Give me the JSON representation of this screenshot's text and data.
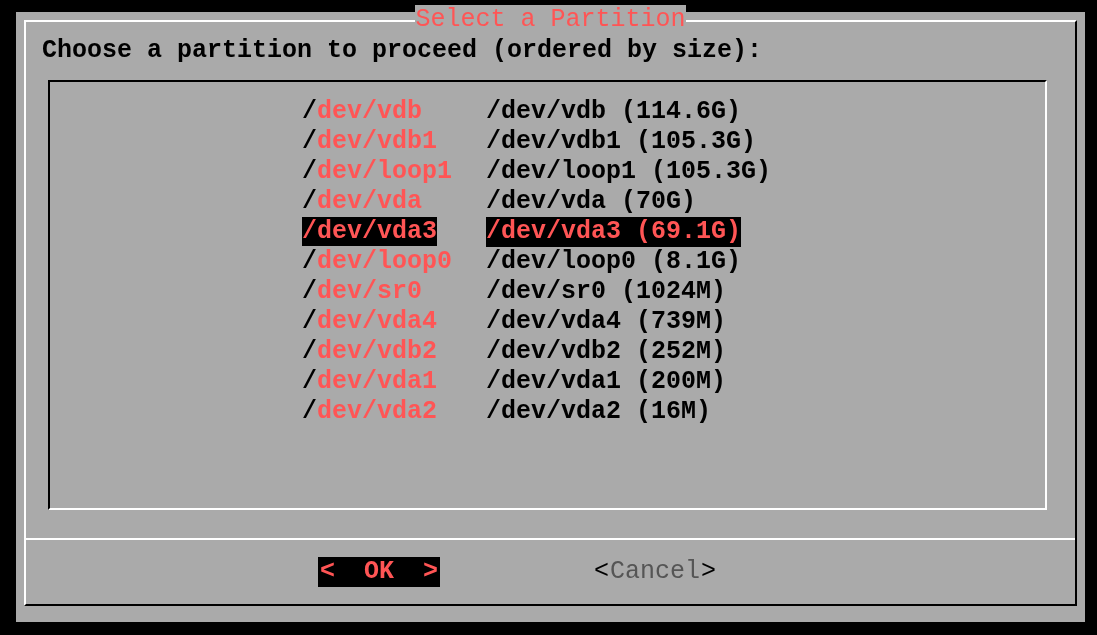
{
  "dialog": {
    "title": "Select a Partition",
    "prompt": "Choose a partition to proceed (ordered by size):",
    "partitions": [
      {
        "tag": "/dev/vdb",
        "item": "/dev/vdb (114.6G)",
        "selected": false
      },
      {
        "tag": "/dev/vdb1",
        "item": "/dev/vdb1 (105.3G)",
        "selected": false
      },
      {
        "tag": "/dev/loop1",
        "item": "/dev/loop1 (105.3G)",
        "selected": false
      },
      {
        "tag": "/dev/vda",
        "item": "/dev/vda (70G)",
        "selected": false
      },
      {
        "tag": "/dev/vda3",
        "item": "/dev/vda3 (69.1G)",
        "selected": true
      },
      {
        "tag": "/dev/loop0",
        "item": "/dev/loop0 (8.1G)",
        "selected": false
      },
      {
        "tag": "/dev/sr0",
        "item": "/dev/sr0 (1024M)",
        "selected": false
      },
      {
        "tag": "/dev/vda4",
        "item": "/dev/vda4 (739M)",
        "selected": false
      },
      {
        "tag": "/dev/vdb2",
        "item": "/dev/vdb2 (252M)",
        "selected": false
      },
      {
        "tag": "/dev/vda1",
        "item": "/dev/vda1 (200M)",
        "selected": false
      },
      {
        "tag": "/dev/vda2",
        "item": "/dev/vda2 (16M)",
        "selected": false
      }
    ],
    "buttons": [
      {
        "left": "<",
        "label": "OK",
        "right": ">",
        "selected": true
      },
      {
        "left": "<",
        "label": "Cancel",
        "right": ">",
        "selected": false
      }
    ]
  }
}
